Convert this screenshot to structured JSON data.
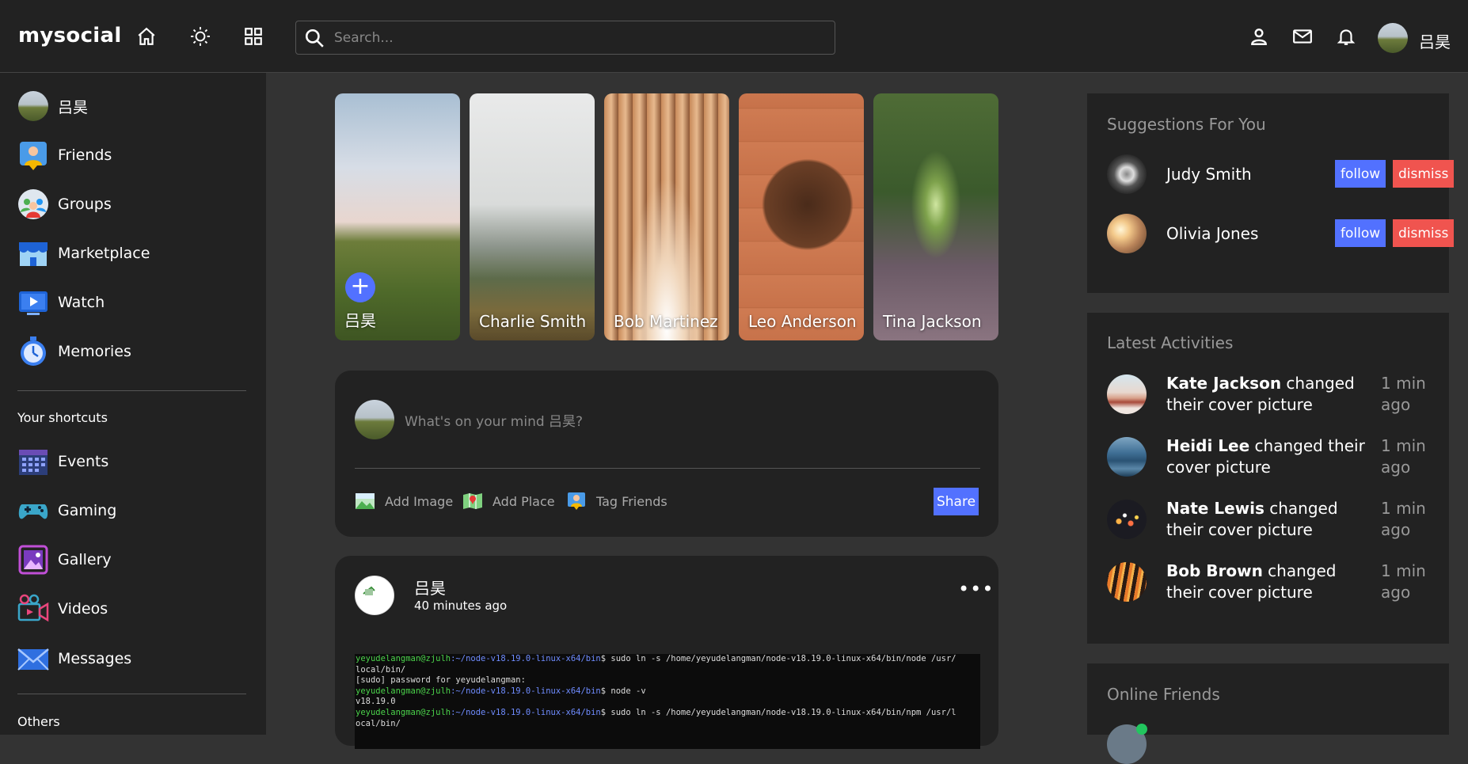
{
  "app": {
    "logo": "mysocial"
  },
  "topbar": {
    "search_placeholder": "Search...",
    "user_name": "吕昊",
    "icons": [
      "home-icon",
      "theme-toggle-icon",
      "apps-grid-icon",
      "person-icon",
      "mail-icon",
      "bell-icon"
    ]
  },
  "sidebar": {
    "items": [
      {
        "label": "吕昊",
        "icon": "user-avatar"
      },
      {
        "label": "Friends",
        "icon": "friends-icon"
      },
      {
        "label": "Groups",
        "icon": "groups-icon"
      },
      {
        "label": "Marketplace",
        "icon": "marketplace-icon"
      },
      {
        "label": "Watch",
        "icon": "watch-icon"
      },
      {
        "label": "Memories",
        "icon": "memories-icon"
      }
    ],
    "shortcuts_title": "Your shortcuts",
    "shortcuts": [
      {
        "label": "Events",
        "icon": "events-icon"
      },
      {
        "label": "Gaming",
        "icon": "gaming-icon"
      },
      {
        "label": "Gallery",
        "icon": "gallery-icon"
      },
      {
        "label": "Videos",
        "icon": "videos-icon"
      },
      {
        "label": "Messages",
        "icon": "messages-icon"
      }
    ],
    "others_title": "Others"
  },
  "stories": [
    {
      "name": "吕昊",
      "add": true
    },
    {
      "name": "Charlie Smith"
    },
    {
      "name": "Bob Martinez"
    },
    {
      "name": "Leo Anderson"
    },
    {
      "name": "Tina Jackson"
    }
  ],
  "compose": {
    "placeholder": "What's on your mind 吕昊?",
    "add_image": "Add Image",
    "add_place": "Add Place",
    "tag_friends": "Tag Friends",
    "share": "Share"
  },
  "post": {
    "author": "吕昊",
    "time": "40 minutes ago",
    "more": "•••",
    "terminal": [
      {
        "user": "yeyudelangman@zjulh",
        "path": ":~/node-v18.19.0-linux-x64/bin",
        "cmd": "$ sudo ln -s /home/yeyudelangman/node-v18.19.0-linux-x64/bin/node /usr/"
      },
      {
        "text": "local/bin/"
      },
      {
        "text": "[sudo] password for yeyudelangman:"
      },
      {
        "user": "yeyudelangman@zjulh",
        "path": ":~/node-v18.19.0-linux-x64/bin",
        "cmd": "$ node -v"
      },
      {
        "text": "v18.19.0"
      },
      {
        "user": "yeyudelangman@zjulh",
        "path": ":~/node-v18.19.0-linux-x64/bin",
        "cmd": "$ sudo ln -s /home/yeyudelangman/node-v18.19.0-linux-x64/bin/npm /usr/l"
      },
      {
        "text": "ocal/bin/"
      }
    ]
  },
  "suggestions": {
    "title": "Suggestions For You",
    "follow_label": "follow",
    "dismiss_label": "dismiss",
    "people": [
      {
        "name": "Judy Smith"
      },
      {
        "name": "Olivia Jones"
      }
    ]
  },
  "activities": {
    "title": "Latest Activities",
    "items": [
      {
        "name": "Kate Jackson",
        "text": " changed their cover picture",
        "time": "1 min ago"
      },
      {
        "name": "Heidi Lee",
        "text": " changed their cover picture",
        "time": "1 min ago"
      },
      {
        "name": "Nate Lewis",
        "text": " changed their cover picture",
        "time": "1 min ago"
      },
      {
        "name": "Bob Brown",
        "text": " changed their cover picture",
        "time": "1 min ago"
      }
    ]
  },
  "online": {
    "title": "Online Friends"
  },
  "colors": {
    "accent": "#5271ff",
    "danger": "#f0544f",
    "bg": "#333333",
    "panel": "#222222",
    "online": "#22c55e"
  }
}
